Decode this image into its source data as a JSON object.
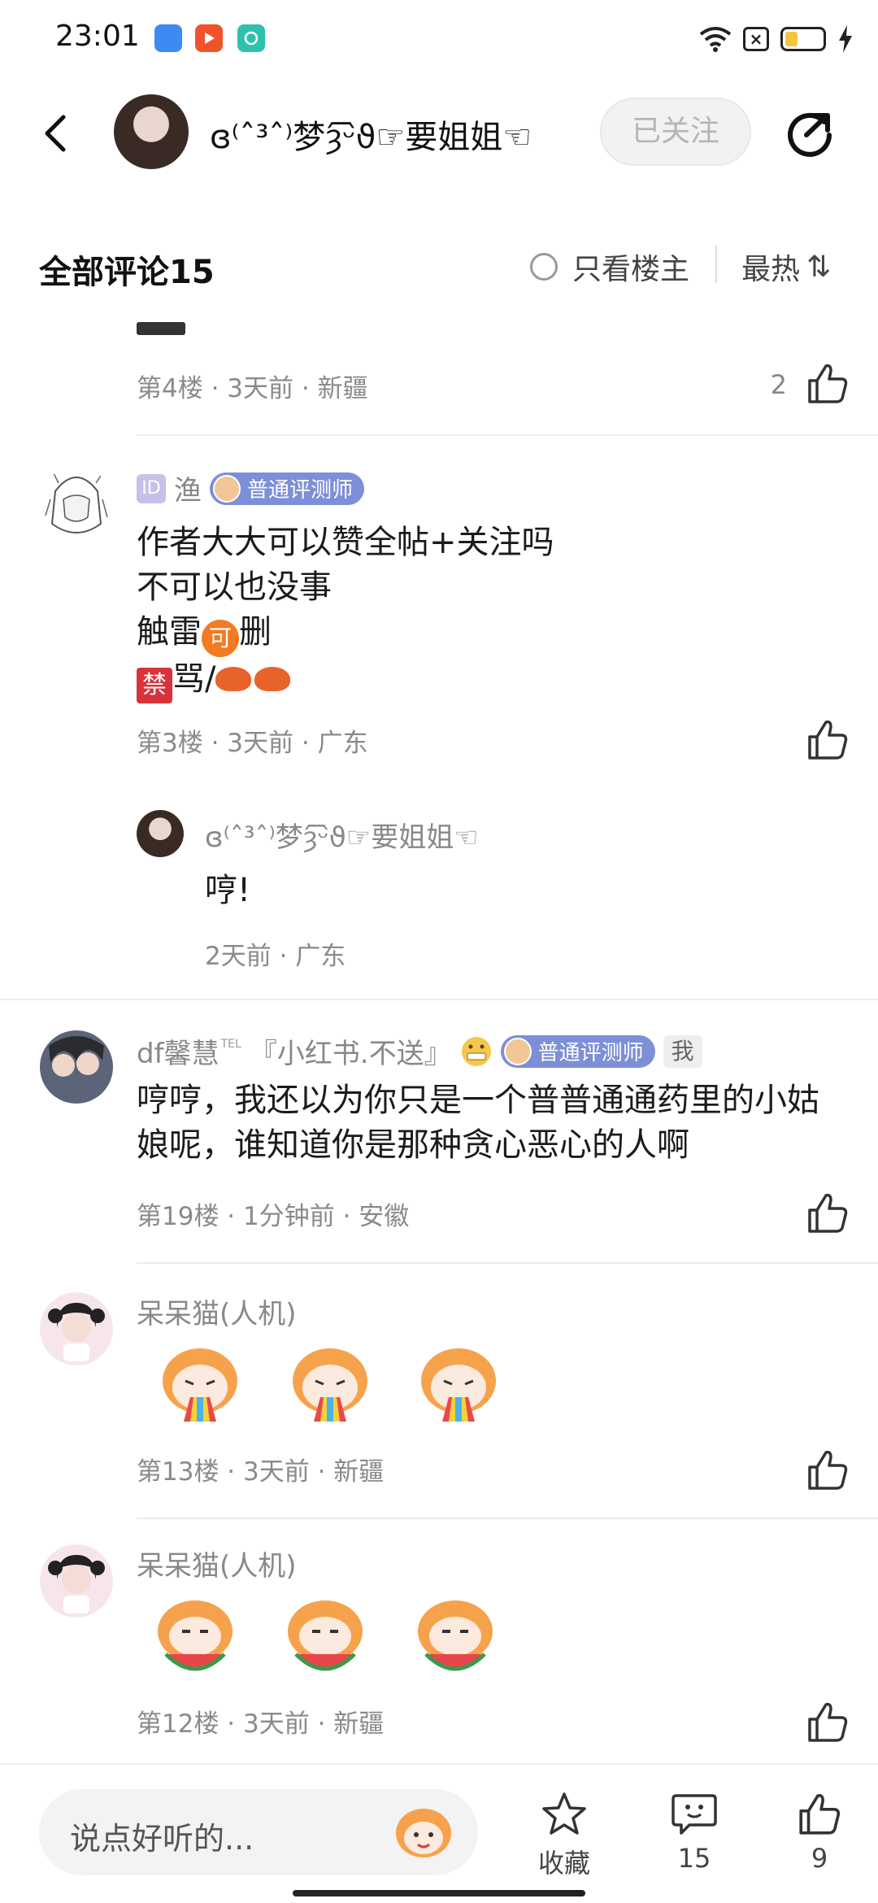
{
  "status": {
    "time": "23:01",
    "battery_level": 0.35
  },
  "header": {
    "name": "ɞ⁽ˆ³ˆ⁾梦ȝ᷇ᵕ᷆ϑ☞要姐姐☜",
    "follow_label": "已关注"
  },
  "comments_bar": {
    "title": "全部评论15",
    "op_only": "只看楼主",
    "sort": "最热",
    "sort_icon": "⇅"
  },
  "comments": [
    {
      "meta": "第4楼 · 3天前 · 新疆",
      "likes": "2"
    },
    {
      "name": "渔",
      "id_badge": "ID",
      "badge": "普通评测师",
      "lines": [
        "作者大大可以赞全帖+关注吗",
        "不可以也没事",
        "触雷",
        "删",
        "骂/"
      ],
      "ok_symbol": "可",
      "ban_symbol": "禁",
      "meta": "第3楼 · 3天前 · 广东"
    },
    {
      "name": "ɞ⁽ˆ³ˆ⁾梦ȝ᷇ᵕ᷆ϑ☞要姐姐☜",
      "body": "哼!",
      "meta": "2天前 · 广东"
    },
    {
      "name": "df馨慧",
      "tel": "TEL",
      "title": "『小红书.不送』",
      "badge": "普通评测师",
      "me": "我",
      "body": "哼哼，我还以为你只是一个普普通通药里的小姑娘呢，谁知道你是那种贪心恶心的人啊",
      "meta": "第19楼 · 1分钟前 · 安徽"
    },
    {
      "name": "呆呆猫(人机)",
      "meta": "第13楼 · 3天前 · 新疆"
    },
    {
      "name": "呆呆猫(人机)",
      "meta": "第12楼 · 3天前 · 新疆"
    }
  ],
  "bottom": {
    "placeholder": "说点好听的...",
    "favorite_label": "收藏",
    "comment_count": "15",
    "like_count": "9"
  }
}
